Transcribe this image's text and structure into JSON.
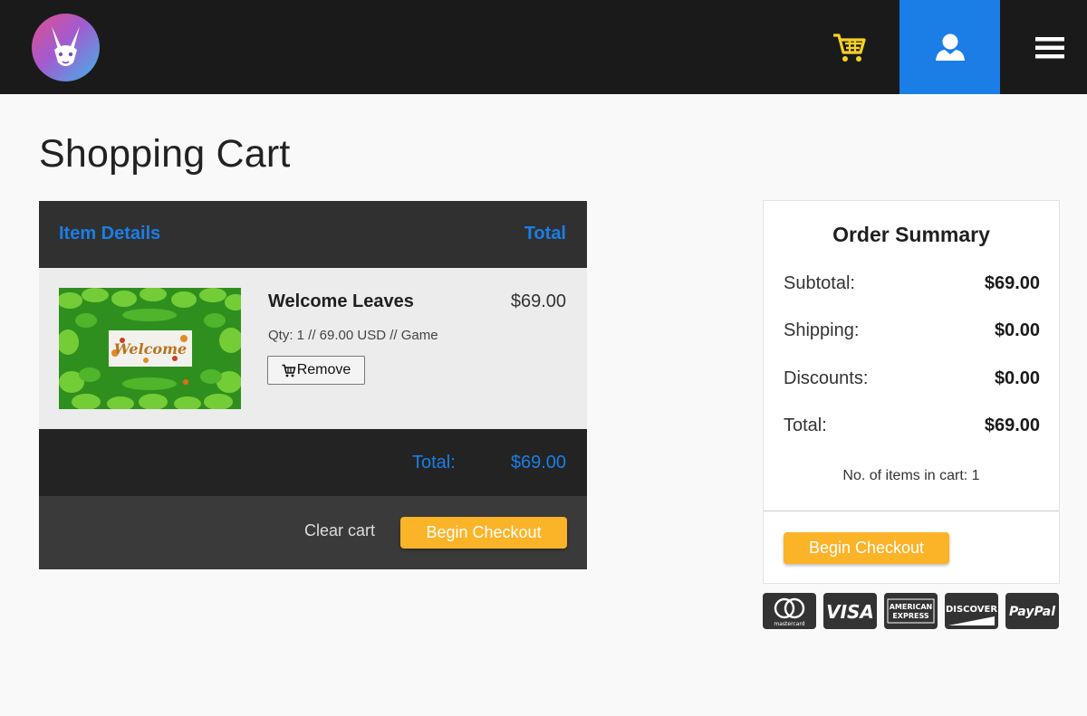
{
  "header": {
    "logo_icon": "rabbit-logo-icon",
    "cart_icon": "shopping-cart-icon",
    "user_icon": "user-icon",
    "menu_icon": "hamburger-menu-icon",
    "colors": {
      "bar": "#1a1a1a",
      "user_button": "#1a7ee6",
      "cart_icon": "#f5d122"
    }
  },
  "page": {
    "title": "Shopping Cart"
  },
  "cart": {
    "columns": {
      "details": "Item Details",
      "total": "Total"
    },
    "items": [
      {
        "name": "Welcome Leaves",
        "price": "$69.00",
        "meta": "Qty: 1 // 69.00 USD // Game",
        "thumbnail_text": "Welcome",
        "remove_label": "Remove"
      }
    ],
    "total_label": "Total:",
    "total_value": "$69.00",
    "clear_label": "Clear cart",
    "checkout_label": "Begin Checkout"
  },
  "summary": {
    "title": "Order Summary",
    "rows": [
      {
        "label": "Subtotal:",
        "value": "$69.00"
      },
      {
        "label": "Shipping:",
        "value": "$0.00"
      },
      {
        "label": "Discounts:",
        "value": "$0.00"
      },
      {
        "label": "Total:",
        "value": "$69.00"
      }
    ],
    "items_count": "No. of items in cart: 1",
    "checkout_label": "Begin Checkout"
  },
  "payment_methods": [
    {
      "icon": "mastercard-icon",
      "label": "mastercard"
    },
    {
      "icon": "visa-icon",
      "label": "VISA"
    },
    {
      "icon": "american-express-icon",
      "label": "AMERICAN EXPRESS"
    },
    {
      "icon": "discover-icon",
      "label": "DISCOVER"
    },
    {
      "icon": "paypal-icon",
      "label": "PayPal"
    }
  ],
  "colors": {
    "accent": "#1a7ee6",
    "checkout_button": "#fbb328"
  }
}
